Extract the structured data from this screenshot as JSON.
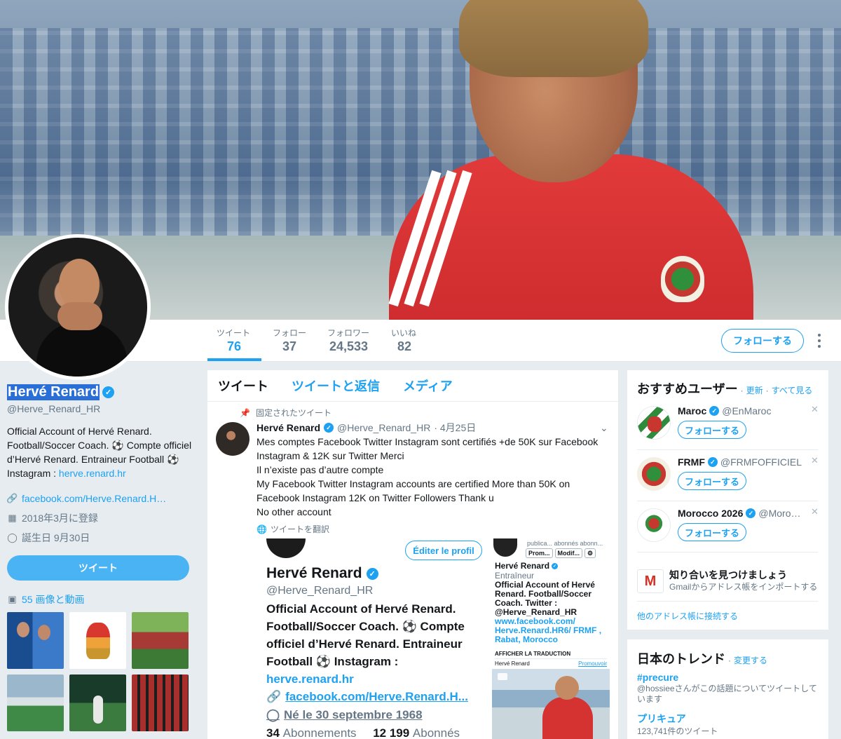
{
  "profile": {
    "name": "Hervé Renard",
    "handle": "@Herve_Renard_HR",
    "bio_line1": "Official Account of Hervé Renard. Football/Soccer Coach. ⚽ Compte officiel d’Hervé Renard. Entraineur Football ⚽ Instagram : ",
    "bio_link": "herve.renard.hr",
    "website": "facebook.com/Herve.Renard.H…",
    "joined": "2018年3月に登録",
    "birthday": "誕生日 9月30日",
    "tweet_button": "ツイート",
    "media_link": "55 画像と動画"
  },
  "nav": {
    "stats": [
      {
        "label": "ツイート",
        "value": "76"
      },
      {
        "label": "フォロー",
        "value": "37"
      },
      {
        "label": "フォロワー",
        "value": "24,533"
      },
      {
        "label": "いいね",
        "value": "82"
      }
    ],
    "follow_button": "フォローする"
  },
  "timeline": {
    "tabs": [
      "ツイート",
      "ツイートと返信",
      "メディア"
    ],
    "pinned_label": "固定されたツイート",
    "tweet": {
      "name": "Hervé Renard",
      "handle": "@Herve_Renard_HR",
      "date": "· 4月25日",
      "lines": [
        "Mes comptes Facebook Twitter Instagram sont certifiés +de 50K sur Facebook",
        "Instagram & 12K sur Twitter Merci",
        "Il n’existe pas d’autre compte",
        "My Facebook Twitter Instagram accounts are certified More than 50K on",
        "Facebook Instagram 12K on Twitter Followers Thank u",
        "No other account"
      ],
      "translate": "ツイートを翻訳"
    },
    "embed_left": {
      "edit_button": "Éditer le profil",
      "name": "Hervé Renard",
      "handle": "@Herve_Renard_HR",
      "bio": "Official Account of Hervé Renard. Football/Soccer Coach. ⚽ Compte officiel d’Hervé Renard. Entraineur Football ⚽ Instagram :",
      "bio_link": "herve.renard.hr",
      "website": "facebook.com/Herve.Renard.H...",
      "birthday": "Né le 30 septembre 1968",
      "following_count": "34",
      "following_label": "Abonnements",
      "followers_count": "12 199",
      "followers_label": "Abonnés"
    },
    "embed_right": {
      "small_stats": "publica... abonnés abonn...",
      "btn1": "Prom...",
      "btn2": "Modif...",
      "btn3": "⚙",
      "name": "Hervé Renard",
      "role": "Entraîneur",
      "bio_black": "Official Account of Hervé Renard. Football/Soccer Coach. Twitter : @Herve_Renard_HR",
      "bio_blue": "www.facebook.com/ Herve.Renard.HR6/ FRMF , Rabat, Morocco",
      "translate": "AFFICHER LA TRADUCTION",
      "promo_name": "Hervé Renard",
      "promo_link": "Promouvoir"
    }
  },
  "suggestions": {
    "title": "おすすめユーザー",
    "refresh": "更新",
    "view_all": "すべて見る",
    "sep": "·",
    "users": [
      {
        "name": "Maroc",
        "handle": "@EnMaroc",
        "follow": "フォローする"
      },
      {
        "name": "FRMF",
        "handle": "@FRMFOFFICIEL",
        "follow": "フォローする"
      },
      {
        "name": "Morocco 2026",
        "handle": "@Moro…",
        "follow": "フォローする"
      }
    ],
    "gmail_title": "知り合いを見つけましょう",
    "gmail_sub": "Gmailからアドレス帳をインポートする",
    "other_ab": "他のアドレス帳に接続する"
  },
  "trends": {
    "title": "日本のトレンド",
    "change": "変更する",
    "sep": "·",
    "items": [
      {
        "name": "#precure",
        "sub": "@hossieeさんがこの話題についてツイートしています"
      },
      {
        "name": "プリキュア",
        "sub": "123,741件のツイート"
      }
    ]
  }
}
